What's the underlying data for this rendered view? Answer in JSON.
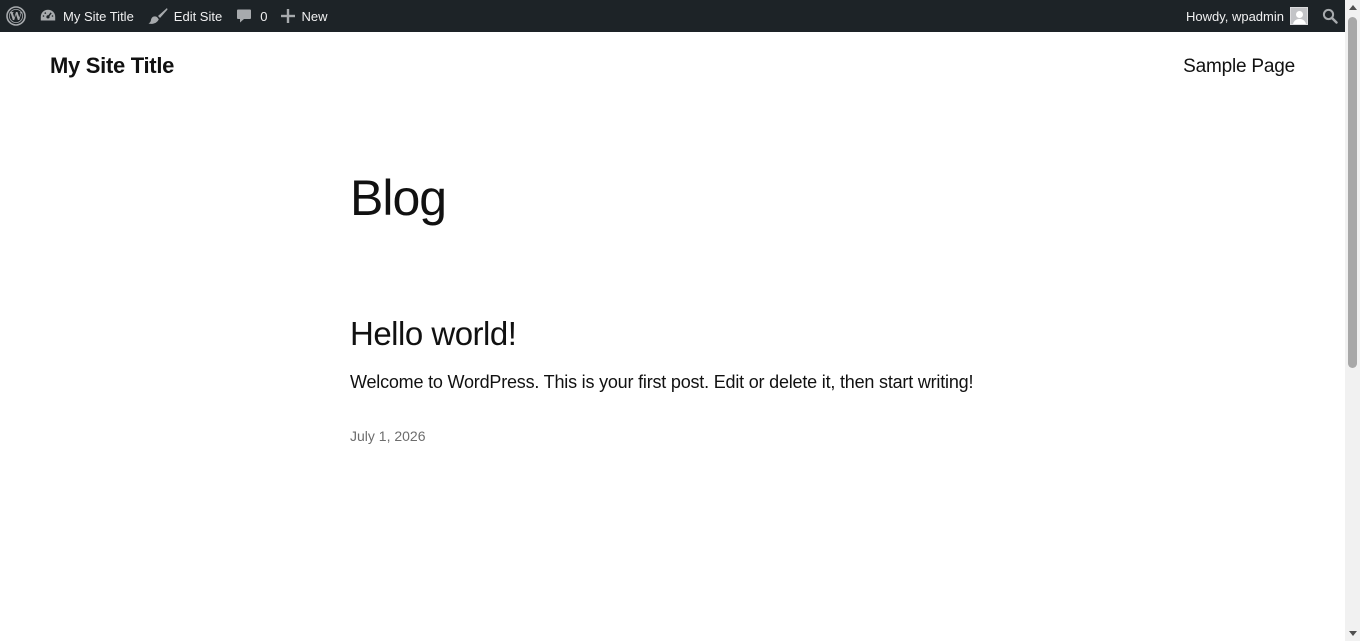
{
  "admin_bar": {
    "site_name": "My Site Title",
    "edit_site": "Edit Site",
    "comments_count": "0",
    "new_label": "New",
    "howdy": "Howdy, wpadmin",
    "background_color": "#1d2327"
  },
  "header": {
    "site_title": "My Site Title",
    "nav": [
      "Sample Page"
    ]
  },
  "main": {
    "page_title": "Blog",
    "posts": [
      {
        "title": "Hello world!",
        "excerpt": "Welcome to WordPress. This is your first post. Edit or delete it, then start writing!",
        "date": "July 1, 2026"
      }
    ]
  }
}
